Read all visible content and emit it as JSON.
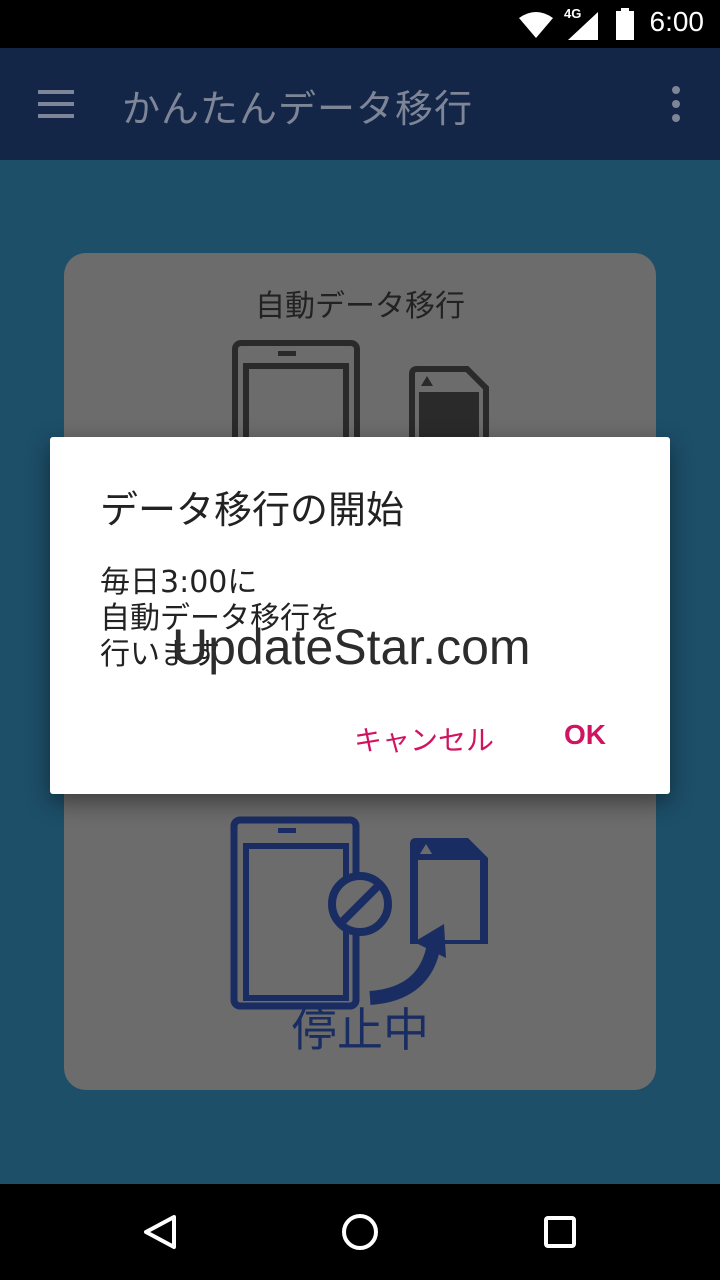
{
  "status_bar": {
    "network": "4G",
    "time": "6:00",
    "icons": [
      "wifi-icon",
      "cellular-signal-icon",
      "battery-icon"
    ]
  },
  "app_bar": {
    "title": "かんたんデータ移行",
    "menu_icon": "hamburger-menu-icon",
    "overflow_icon": "more-vertical-icon"
  },
  "auto_transfer_card": {
    "title": "自動データ移行"
  },
  "status_card": {
    "status_label": "停止中"
  },
  "dialog": {
    "title": "データ移行の開始",
    "message": "毎日3:00に\n自動データ移行を\n行います",
    "cancel_label": "キャンセル",
    "ok_label": "OK",
    "accent_color": "#d0145f"
  },
  "watermark": "UpdateStar.com",
  "nav_bar": {
    "buttons": [
      "back-icon",
      "home-icon",
      "recents-icon"
    ]
  }
}
